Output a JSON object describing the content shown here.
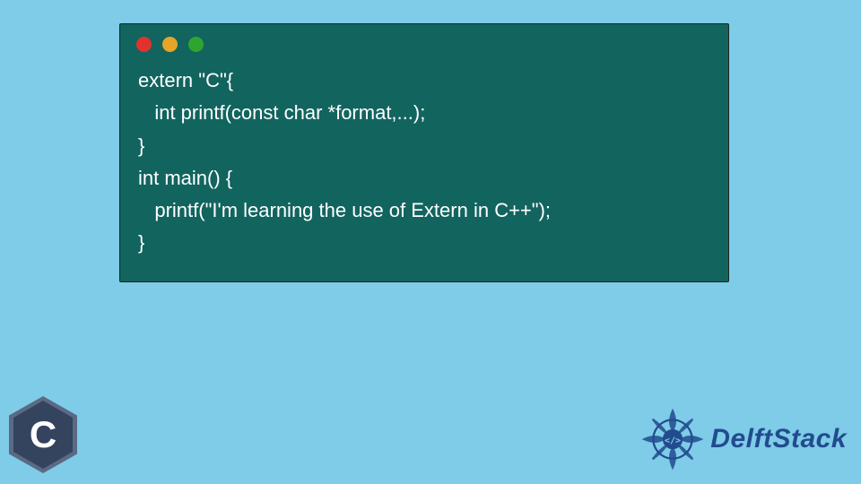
{
  "code": {
    "lines": [
      "extern \"C\"{",
      "   int printf(const char *format,...);",
      "}",
      "int main() {",
      "   printf(\"I'm learning the use of Extern in C++\");",
      "}"
    ]
  },
  "window": {
    "controls": [
      "close",
      "minimize",
      "maximize"
    ]
  },
  "logos": {
    "c_letter": "C",
    "brand_name": "DelftStack",
    "brand_badge_glyph": "</>"
  },
  "colors": {
    "background": "#7ecce8",
    "window_bg": "#12645f",
    "code_text": "#ffffff",
    "brand_color": "#224b8e"
  }
}
